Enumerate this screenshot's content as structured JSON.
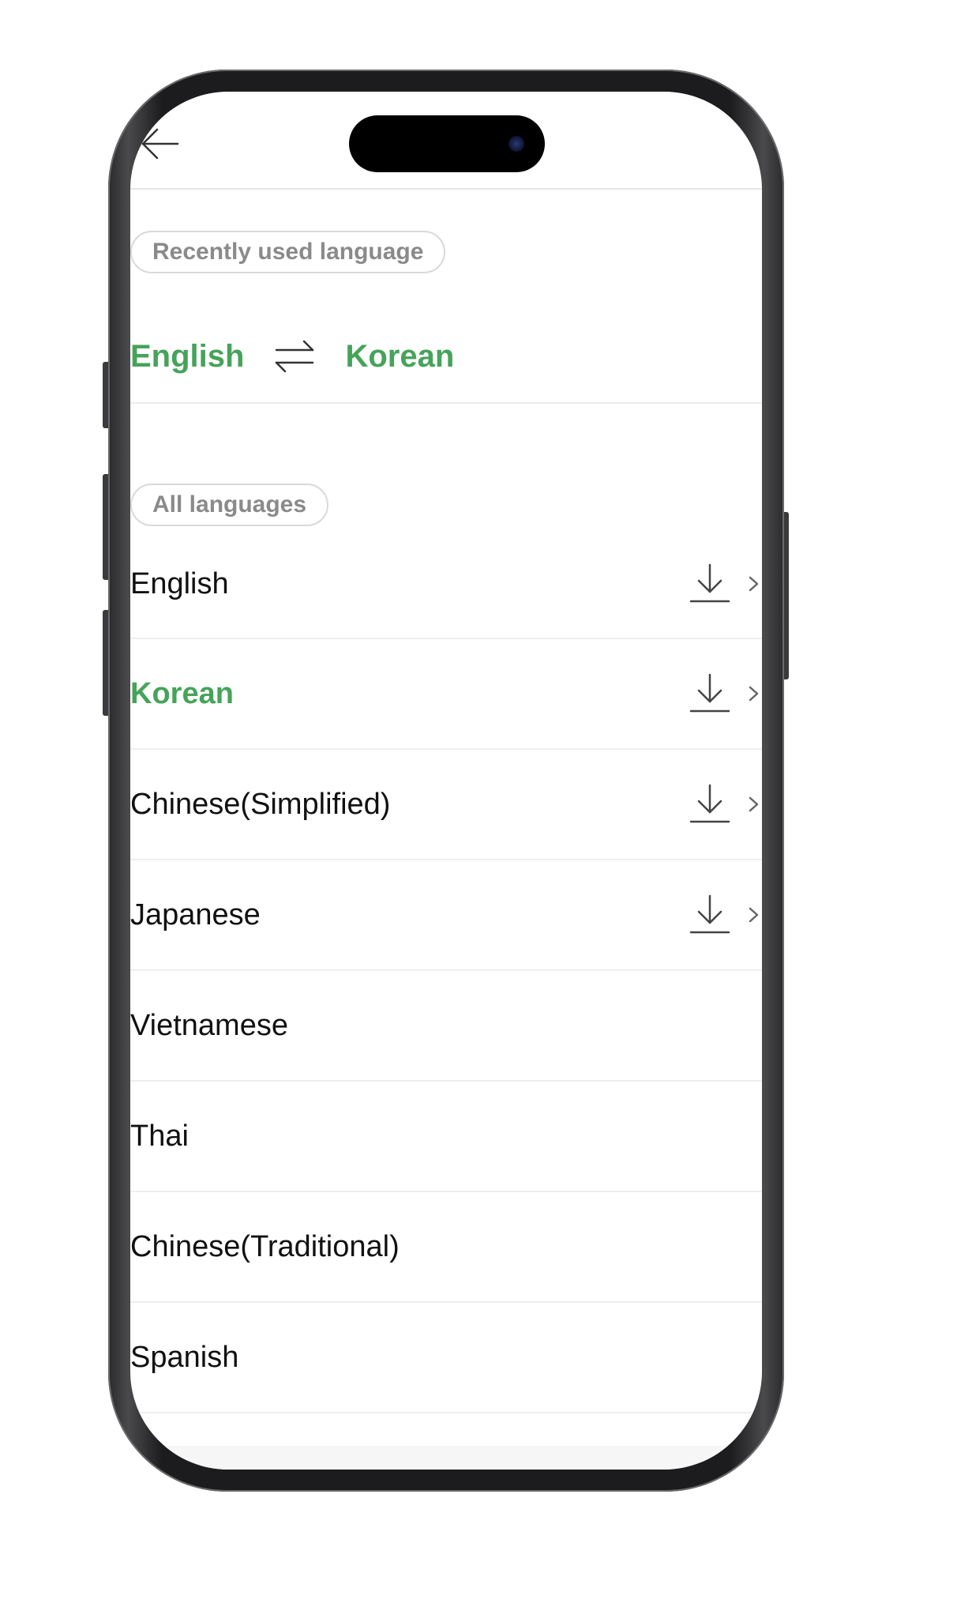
{
  "header": {
    "back_icon": "arrow-left-icon"
  },
  "recent": {
    "chip_label": "Recently used language",
    "source_language": "English",
    "target_language": "Korean",
    "swap_icon": "swap-arrows-icon"
  },
  "all": {
    "chip_label": "All languages"
  },
  "languages": [
    {
      "label": "English",
      "selected": false,
      "downloadable": true
    },
    {
      "label": "Korean",
      "selected": true,
      "downloadable": true
    },
    {
      "label": "Chinese(Simplified)",
      "selected": false,
      "downloadable": true
    },
    {
      "label": "Japanese",
      "selected": false,
      "downloadable": true
    },
    {
      "label": "Vietnamese",
      "selected": false,
      "downloadable": false
    },
    {
      "label": "Thai",
      "selected": false,
      "downloadable": false
    },
    {
      "label": "Chinese(Traditional)",
      "selected": false,
      "downloadable": false
    },
    {
      "label": "Spanish",
      "selected": false,
      "downloadable": false
    }
  ],
  "colors": {
    "accent_green": "#46a35a",
    "text_primary": "#111111",
    "chip_text": "#8a8a8a"
  }
}
